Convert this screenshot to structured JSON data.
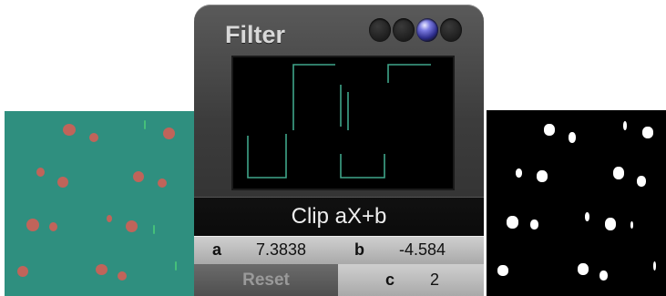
{
  "panel": {
    "title": "Filter",
    "caption": "Clip aX+b",
    "params": {
      "a_label": "a",
      "a_value": "7.3838",
      "b_label": "b",
      "b_value": "-4.584",
      "c_label": "c",
      "c_value": "2"
    },
    "reset_label": "Reset"
  },
  "colors": {
    "scope_trace": "#3fa58a",
    "left_bg": "#2f8f7f",
    "left_blob": "#c0645a",
    "right_bg": "#000000",
    "right_blob": "#ffffff",
    "indicator_active": "#7a7ae0"
  },
  "icons": {
    "indicators": [
      "indicator-dot-icon",
      "indicator-dot-icon",
      "indicator-dot-active-icon",
      "indicator-dot-icon"
    ]
  }
}
